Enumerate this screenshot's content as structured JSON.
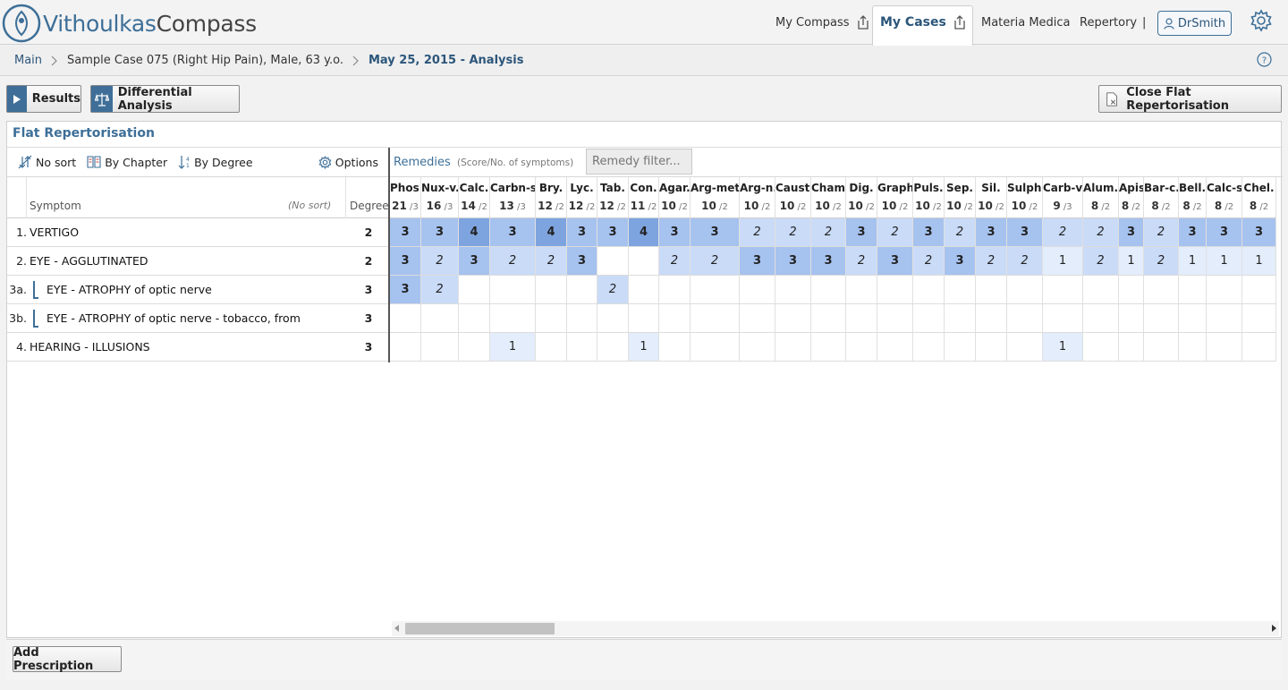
{
  "header": {
    "logo_part1": "Vithoulkas",
    "logo_part2": "Compass",
    "nav": {
      "my_compass": "My Compass",
      "my_cases": "My Cases",
      "materia_medica": "Materia Medica",
      "repertory": "Repertory",
      "separator": "|",
      "user": "DrSmith"
    }
  },
  "breadcrumb": {
    "main": "Main",
    "case": "Sample Case 075 (Right Hip Pain), Male, 63 y.o.",
    "analysis": "May 25, 2015 - Analysis"
  },
  "actions": {
    "results": "Results",
    "differential": "Differential Analysis",
    "close_flat": "Close Flat Repertorisation"
  },
  "panel": {
    "title": "Flat Repertorisation",
    "sort": {
      "no_sort": "No sort",
      "by_chapter": "By Chapter",
      "by_degree": "By Degree",
      "options": "Options"
    },
    "remedies_label": "Remedies",
    "remedies_sub": "(Score/No. of symptoms)",
    "filter_placeholder": "Remedy filter...",
    "headers": {
      "symptom": "Symptom",
      "nosort": "(No sort)",
      "degree": "Degree"
    }
  },
  "symptoms": [
    {
      "num": "1.",
      "text": "VERTIGO",
      "degree": "2",
      "indent": false
    },
    {
      "num": "2.",
      "text": "EYE - AGGLUTINATED",
      "degree": "2",
      "indent": false
    },
    {
      "num": "3a.",
      "text": "EYE - ATROPHY of optic nerve",
      "degree": "3",
      "indent": true
    },
    {
      "num": "3b.",
      "text": "EYE - ATROPHY of optic nerve - tobacco, from",
      "degree": "3",
      "indent": true
    },
    {
      "num": "4.",
      "text": "HEARING - ILLUSIONS",
      "degree": "3",
      "indent": false
    }
  ],
  "remedies": [
    {
      "name": "Phos.",
      "score": "21",
      "count": "3"
    },
    {
      "name": "Nux-v.",
      "score": "16",
      "count": "3"
    },
    {
      "name": "Calc.",
      "score": "14",
      "count": "2"
    },
    {
      "name": "Carbn-s.",
      "score": "13",
      "count": "3"
    },
    {
      "name": "Bry.",
      "score": "12",
      "count": "2"
    },
    {
      "name": "Lyc.",
      "score": "12",
      "count": "2"
    },
    {
      "name": "Tab.",
      "score": "12",
      "count": "2"
    },
    {
      "name": "Con.",
      "score": "11",
      "count": "2"
    },
    {
      "name": "Agar.",
      "score": "10",
      "count": "2"
    },
    {
      "name": "Arg-met.",
      "score": "10",
      "count": "2"
    },
    {
      "name": "Arg-n.",
      "score": "10",
      "count": "2"
    },
    {
      "name": "Caust.",
      "score": "10",
      "count": "2"
    },
    {
      "name": "Cham.",
      "score": "10",
      "count": "2"
    },
    {
      "name": "Dig.",
      "score": "10",
      "count": "2"
    },
    {
      "name": "Graph.",
      "score": "10",
      "count": "2"
    },
    {
      "name": "Puls.",
      "score": "10",
      "count": "2"
    },
    {
      "name": "Sep.",
      "score": "10",
      "count": "2"
    },
    {
      "name": "Sil.",
      "score": "10",
      "count": "2"
    },
    {
      "name": "Sulph.",
      "score": "10",
      "count": "2"
    },
    {
      "name": "Carb-v.",
      "score": "9",
      "count": "3"
    },
    {
      "name": "Alum.",
      "score": "8",
      "count": "2"
    },
    {
      "name": "Apis",
      "score": "8",
      "count": "2"
    },
    {
      "name": "Bar-c.",
      "score": "8",
      "count": "2"
    },
    {
      "name": "Bell.",
      "score": "8",
      "count": "2"
    },
    {
      "name": "Calc-s.",
      "score": "8",
      "count": "2"
    },
    {
      "name": "Chel.",
      "score": "8",
      "count": "2"
    }
  ],
  "grid": [
    [
      "3b",
      "3b",
      "4b",
      "3b",
      "4b",
      "3b",
      "3b",
      "4b",
      "3b",
      "3b",
      "2i",
      "2i",
      "2i",
      "3b",
      "2i",
      "3b",
      "2i",
      "3b",
      "3b",
      "2i",
      "2i",
      "3b",
      "2i",
      "3b",
      "3b",
      "3b"
    ],
    [
      "3b",
      "2i",
      "3b",
      "2i",
      "2i",
      "3b",
      "",
      "",
      "2i",
      "2i",
      "3b",
      "3b",
      "3b",
      "2i",
      "3b",
      "2i",
      "3b",
      "2i",
      "2i",
      "1",
      "2i",
      "1",
      "2i",
      "1",
      "1",
      "1"
    ],
    [
      "3b",
      "2i",
      "",
      "",
      "",
      "",
      "2i",
      "",
      "",
      "",
      "",
      "",
      "",
      "",
      "",
      "",
      "",
      "",
      "",
      "",
      "",
      "",
      "",
      "",
      "",
      ""
    ],
    [
      "",
      "",
      "",
      "",
      "",
      "",
      "",
      "",
      "",
      "",
      "",
      "",
      "",
      "",
      "",
      "",
      "",
      "",
      "",
      "",
      "",
      "",
      "",
      "",
      "",
      ""
    ],
    [
      "",
      "",
      "",
      "1",
      "",
      "",
      "",
      "1",
      "",
      "",
      "",
      "",
      "",
      "",
      "",
      "",
      "",
      "",
      "",
      "1",
      "",
      "",
      "",
      "",
      "",
      ""
    ]
  ],
  "prescription": "Add Prescription",
  "colors": {
    "accent": "#3d6f98",
    "cell4": "#7ea4df",
    "cell3": "#a6c2ef",
    "cell2": "#c9dbf7",
    "cell1": "#e3edfb"
  }
}
